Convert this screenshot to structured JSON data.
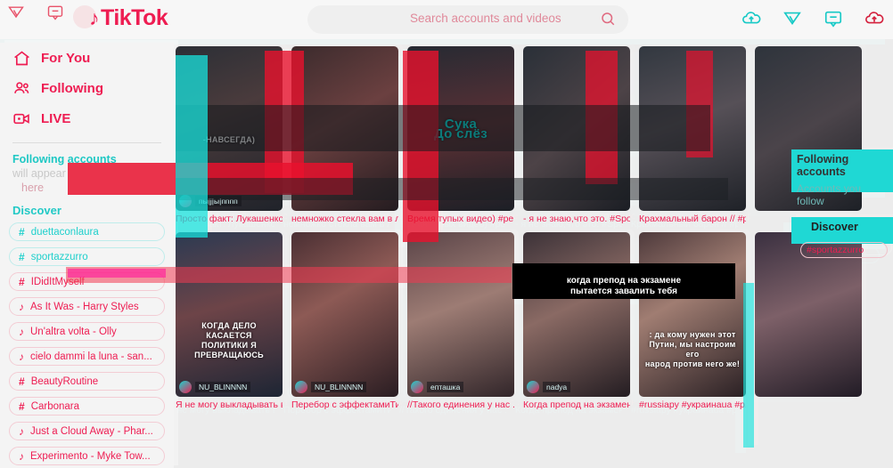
{
  "app": {
    "name": "TikTok",
    "logo_text": "TikTok",
    "note_glyph": "♪"
  },
  "header": {
    "search": {
      "placeholder": "Search accounts and videos",
      "value": ""
    },
    "icons": [
      {
        "name": "upload-icon",
        "glyph": "upload"
      },
      {
        "name": "send-icon",
        "glyph": "plane"
      },
      {
        "name": "message-icon",
        "glyph": "bubble"
      },
      {
        "name": "upload-icon-ghost",
        "glyph": "upload"
      }
    ],
    "ghost_icons": [
      {
        "name": "send-icon",
        "glyph": "plane"
      },
      {
        "name": "message-icon",
        "glyph": "bubble"
      }
    ]
  },
  "sidebar": {
    "nav": [
      {
        "label": "For You",
        "icon": "home-icon",
        "active": true
      },
      {
        "label": "Following",
        "icon": "people-icon",
        "active": false
      },
      {
        "label": "LIVE",
        "icon": "live-icon",
        "active": false
      }
    ],
    "following_title": "Following accounts",
    "following_title_alt": "Accounts you follow",
    "following_note": "will appear",
    "following_note2": "here",
    "discover_label": "Discover",
    "chips": [
      {
        "type": "hash",
        "label": "duettaconlaura"
      },
      {
        "type": "hash",
        "label": "sportazzurro"
      },
      {
        "type": "hash",
        "label": "IDidItMyself"
      },
      {
        "type": "music",
        "label": "As It Was - Harry Styles"
      },
      {
        "type": "music",
        "label": "Un'altra volta - Olly"
      },
      {
        "type": "music",
        "label": "cielo dammi la luna - san..."
      },
      {
        "type": "hash",
        "label": "BeautyRoutine"
      },
      {
        "type": "hash",
        "label": "Carbonara"
      },
      {
        "type": "music",
        "label": "Just a Cloud Away - Phar..."
      },
      {
        "type": "music",
        "label": "Experimento - Myke Tow..."
      }
    ],
    "ghost_chip": {
      "type": "hash",
      "label": "sportazzurro"
    }
  },
  "right_ghost_panel": {
    "title": "Following accounts",
    "subtitle": "Accounts you follow",
    "discover": "Discover",
    "chip": "#sportazzurro"
  },
  "feed": {
    "row1": [
      {
        "caption": "Просто факт: Лукашенко ...",
        "username": "пы|j|ы|пппп",
        "overlay": "-НАВСЕГДА)",
        "tone": "dark1"
      },
      {
        "caption": "немножко стекла вам в л...",
        "username": "",
        "overlay": "",
        "tone": "dark2"
      },
      {
        "caption": "Время тупых видео) #ре...",
        "username": "",
        "overlay": "Сука\nДо слёз",
        "tone": "dark3"
      },
      {
        "caption": "- я не знаю,что это. #Spor...",
        "username": "",
        "overlay": "",
        "tone": "dark4"
      },
      {
        "caption": "Крахмальный барон // #р...",
        "username": "",
        "overlay": "",
        "tone": "dark5"
      },
      {
        "caption": "",
        "username": "",
        "overlay": "",
        "tone": "dark6"
      }
    ],
    "row2": [
      {
        "caption": "Я не могу выкладывать в...",
        "username": "NU_BLINNNN",
        "overlay": "КОГДА ДЕЛО КАСАЕТСЯ\nПОЛИТИКИ Я ПРЕВРАЩАЮСЬ",
        "tone": "p1"
      },
      {
        "caption": "Перебор с эффектамиТи...",
        "username": "NU_BLINNNN",
        "overlay": "",
        "tone": "p2"
      },
      {
        "caption": "//Такого единения у нас ...",
        "username": "епташка",
        "overlay": "",
        "tone": "p3"
      },
      {
        "caption": "Когда препод на экзамен...",
        "username": "nadya",
        "overlay": "",
        "tone": "p4"
      },
      {
        "caption": "#russiaру #украинаua #р...",
        "username": "",
        "overlay": ": да кому нужен этот\nПутин, мы настроим его\nнарод против него же!",
        "tone": "p5"
      },
      {
        "caption": "",
        "username": "",
        "overlay": "",
        "tone": "p6"
      }
    ],
    "floating_overlay": "когда препод на экзамене\nпытается завалить тебя"
  },
  "colors": {
    "brand_red": "#ee1d52",
    "brand_cyan": "#00f2ea",
    "chan_red": "#ff2a2a",
    "chan_cyan": "#16e0e0",
    "page_bg": "#ececec",
    "sidebar_bg": "#f4f4f4"
  }
}
